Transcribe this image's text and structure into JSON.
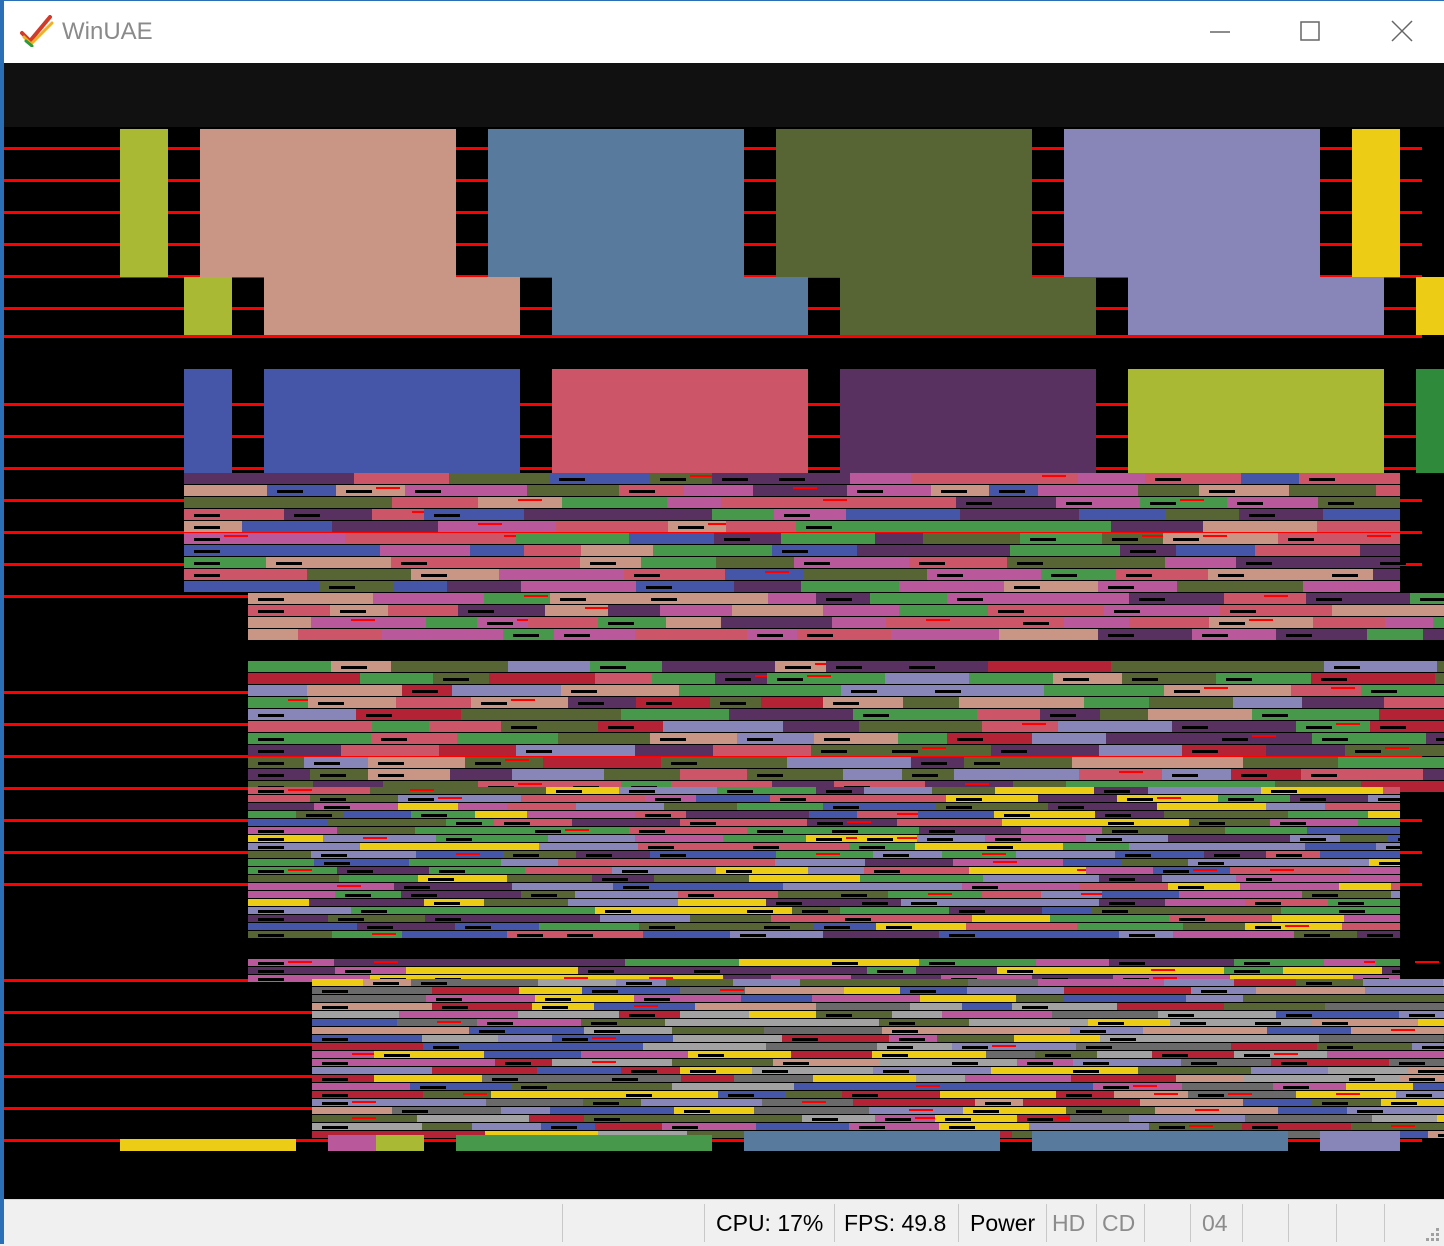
{
  "window": {
    "title": "WinUAE",
    "logo_icon": "winuae-checkmark-icon",
    "controls": [
      "minimize-icon",
      "maximize-icon",
      "close-icon"
    ]
  },
  "emulator_display": {
    "background": "#000000",
    "border_color": "#111111",
    "scanline_color": "#ff0000",
    "palette": {
      "olive": "#aab934",
      "tan": "#c99685",
      "steel": "#587a9c",
      "moss": "#576534",
      "lavender": "#8886b9",
      "gold": "#eccc15",
      "royal": "#4555a8",
      "rose": "#cd5568",
      "plum": "#583161",
      "green": "#48984c",
      "magenta": "#b9599b",
      "crimson": "#b42236",
      "silver": "#a2a2a2",
      "grey": "#6a6a6a",
      "emerald": "#2f8a3c"
    }
  },
  "statusbar": {
    "cpu": "CPU: 17%",
    "fps": "FPS: 49.8",
    "power": "Power",
    "hd": "HD",
    "cd": "CD",
    "drive": "04",
    "grip_icon": "resize-grip-icon"
  }
}
